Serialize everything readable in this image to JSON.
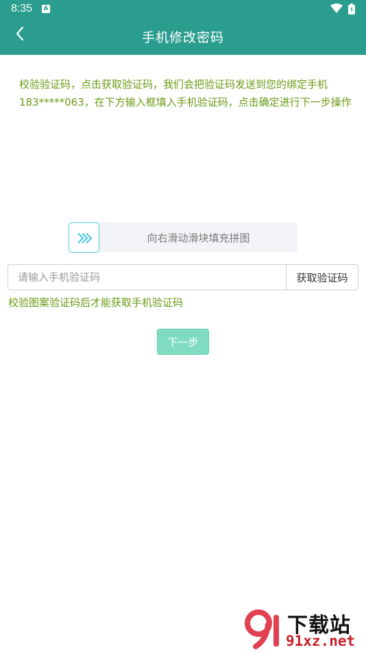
{
  "status_bar": {
    "time": "8:35",
    "notification_icon": "A"
  },
  "header": {
    "title": "手机修改密码",
    "back_icon": "chevron-left-icon"
  },
  "instruction": "校验验证码，点击获取验证码，我们会把验证码发送到您的绑定手机183*****063，在下方输入框填入手机验证码，点击确定进行下一步操作",
  "slider": {
    "text": "向右滑动滑块填充拼图",
    "handle_icon": "double-chevron-right-icon"
  },
  "code_input": {
    "placeholder": "请输入手机验证码",
    "value": ""
  },
  "get_code_button": "获取验证码",
  "verify_hint": "校验图案验证码后才能获取手机验证码",
  "next_button": "下一步",
  "watermark": {
    "title": "下载站",
    "url": "91xz.net"
  },
  "colors": {
    "primary": "#2a9d8f",
    "hint_text": "#6a9a14",
    "next_button": "#7fdcc2",
    "slider_accent": "#4cc8d6"
  }
}
